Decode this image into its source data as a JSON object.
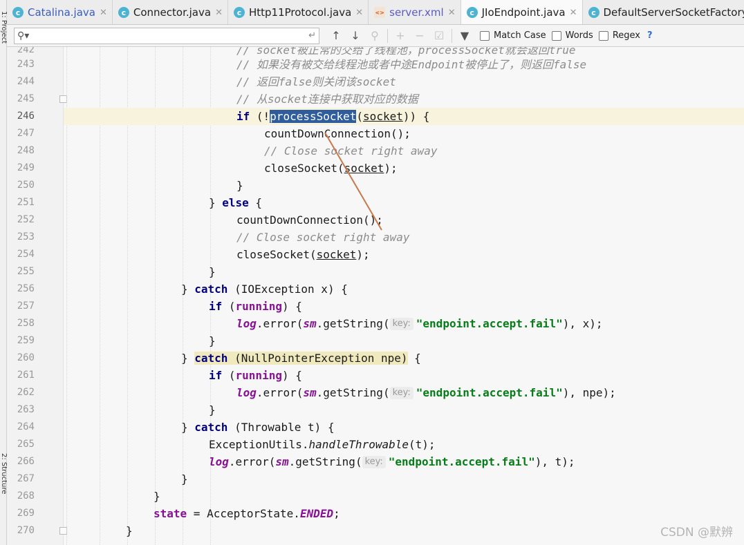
{
  "left_strip": {
    "top_label": "1: Project",
    "bottom_label": "2: Structure"
  },
  "tabs": [
    {
      "label": "Catalina.java",
      "icon": "java-class-icon"
    },
    {
      "label": "Connector.java",
      "icon": "java-class-icon"
    },
    {
      "label": "Http11Protocol.java",
      "icon": "java-class-icon"
    },
    {
      "label": "server.xml",
      "icon": "xml-file-icon"
    },
    {
      "label": "JIoEndpoint.java",
      "icon": "java-class-icon",
      "active": true
    },
    {
      "label": "DefaultServerSocketFactory.java",
      "icon": "java-class-icon"
    }
  ],
  "search": {
    "placeholder": "",
    "match_case": "Match Case",
    "words": "Words",
    "regex": "Regex",
    "help": "?"
  },
  "editor": {
    "line_numbers": [
      "242",
      "243",
      "244",
      "245",
      "246",
      "247",
      "248",
      "249",
      "250",
      "251",
      "252",
      "253",
      "254",
      "255",
      "256",
      "257",
      "258",
      "259",
      "260",
      "261",
      "262",
      "263",
      "264",
      "265",
      "266",
      "267",
      "268",
      "269",
      "270"
    ],
    "current_line": "246",
    "lines": {
      "l242": "// socket被正常的交给了线程池，processSocket就会返回true",
      "l243": "// 如果没有被交给线程池或者中途Endpoint被停止了，则返回false",
      "l244": "// 返回false则关闭该socket",
      "l245": "// 从socket连接中获取对应的数据",
      "if": "if",
      "excl": " (!",
      "processSocket": "processSocket",
      "socket": "socket",
      "countDownConnection": "countDownConnection();",
      "close_comment": "// Close socket right away",
      "closeSocket_pre": "closeSocket(",
      "closeSocket_post": ");",
      "brace_close": "}",
      "else": "else",
      "catch": "catch",
      "ioexception": "(IOException x) {",
      "npe": "(NullPointerException npe)",
      "throwable": "(Throwable t) {",
      "running": "running",
      "log": "log",
      "error_pre": ".error(",
      "sm": "sm",
      "getString": ".getString(",
      "key_hint": "key:",
      "fail_key": "\"endpoint.accept.fail\"",
      "x_tail": "), x);",
      "npe_tail": "), npe);",
      "t_tail": "), t);",
      "exutils": "ExceptionUtils.",
      "handleThrowable": "handleThrowable",
      "handle_tail": "(t);",
      "state": "state",
      "state_assign": " = AcceptorState.",
      "ended": "ENDED",
      "semicolon": ";"
    }
  },
  "watermark": "CSDN @默辨",
  "colors": {
    "selection": "#2f5d9b",
    "current_line": "#f8f3dd",
    "arrow": "#c8784a"
  }
}
